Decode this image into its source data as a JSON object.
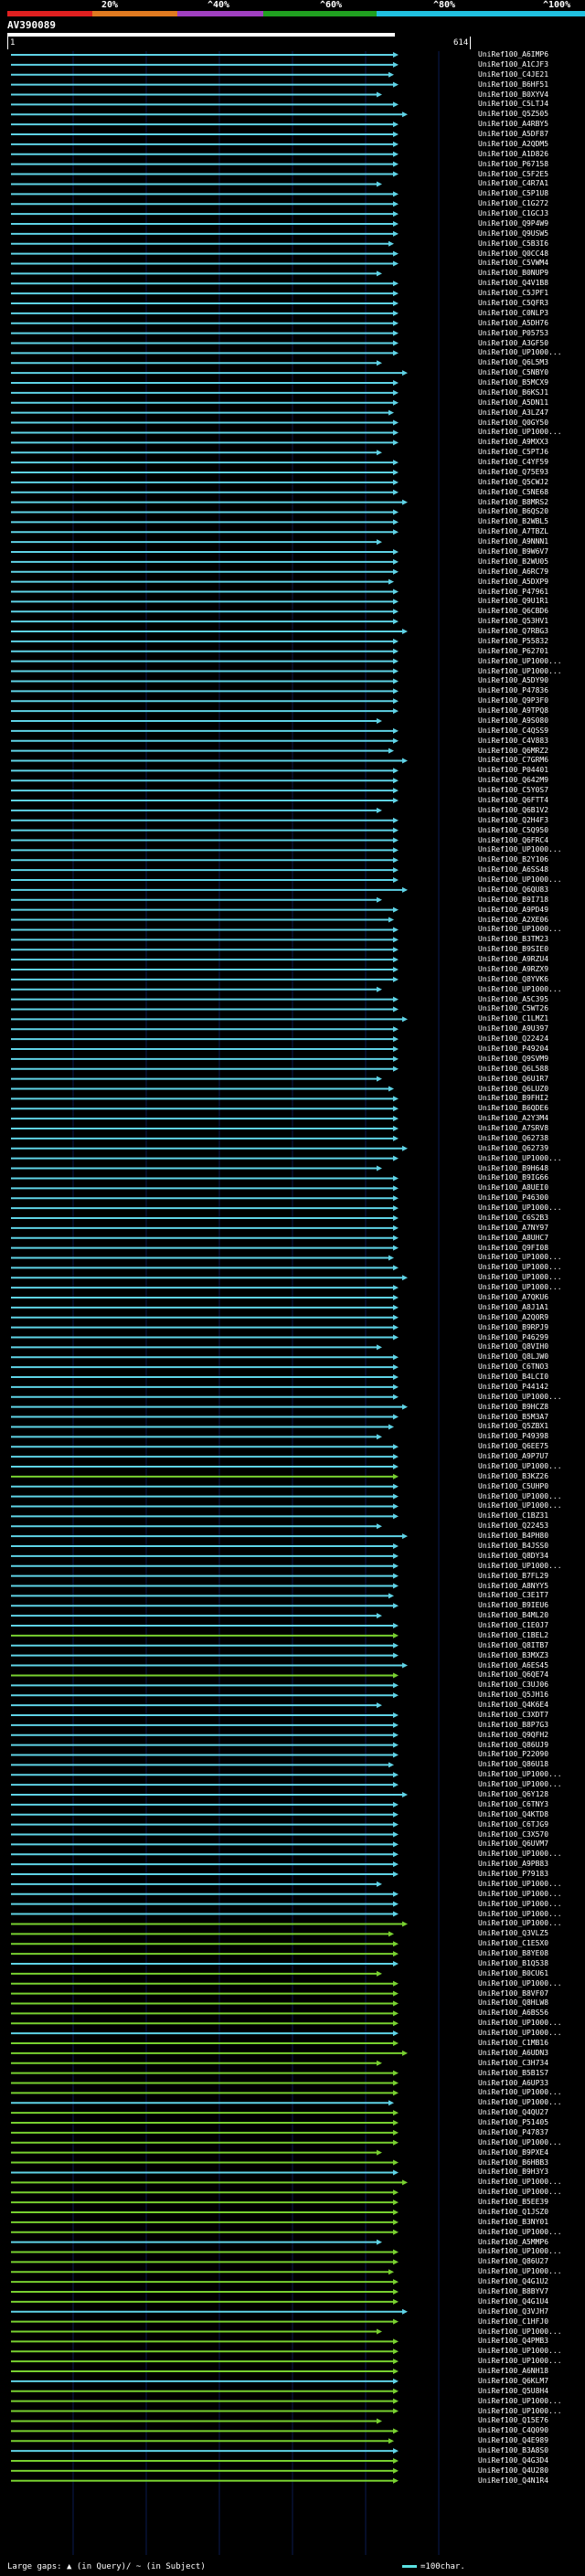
{
  "scale": {
    "ticks": [
      "20%",
      "^40%",
      "^60%",
      "^80%",
      "^100%"
    ],
    "segments": [
      {
        "color": "#e02020"
      },
      {
        "color": "#e07a20"
      },
      {
        "color": "#a040c0"
      },
      {
        "color": "#20a020"
      },
      {
        "color": "#20c0e0"
      }
    ]
  },
  "query": {
    "name": "AV390089",
    "start": "1",
    "end": "614"
  },
  "colors": {
    "cyan": "#5fd3e6",
    "green": "#78d030",
    "grid": "#0a1a50"
  },
  "hits": [
    "UniRef100_A6IMP6",
    "UniRef100_A1CJF3",
    "UniRef100_C4JE21",
    "UniRef100_B6HF51",
    "UniRef100_B0XYV4",
    "UniRef100_C5LTJ4",
    "UniRef100_Q5Z505",
    "UniRef100_A4RBY5",
    "UniRef100_A5DF87",
    "UniRef100_A2QDM5",
    "UniRef100_A1D826",
    "UniRef100_P67158",
    "UniRef100_C5F2E5",
    "UniRef100_C4R7A1",
    "UniRef100_C5P1U8",
    "UniRef100_C1G272",
    "UniRef100_C1GCJ3",
    "UniRef100_Q9P4W9",
    "UniRef100_Q9USW5",
    "UniRef100_C5B3I6",
    "UniRef100_Q0CC48",
    "UniRef100_C5VWM4",
    "UniRef100_B0NUP9",
    "UniRef100_Q4V1B8",
    "UniRef100_C5JPF1",
    "UniRef100_C5QFR3",
    "UniRef100_C0NLP3",
    "UniRef100_A5DH76",
    "UniRef100_P05753",
    "UniRef100_A3GF50",
    "UniRef100_UP1000...",
    "UniRef100_Q6L5M3",
    "UniRef100_C5NBY0",
    "UniRef100_B5MCX9",
    "UniRef100_B6KSJ1",
    "UniRef100_A5DN11",
    "UniRef100_A3LZ47",
    "UniRef100_Q0GY50",
    "UniRef100_UP1000...",
    "UniRef100_A9MXX3",
    "UniRef100_C5PTJ6",
    "UniRef100_C4YF59",
    "UniRef100_Q75E93",
    "UniRef100_Q5CWJ2",
    "UniRef100_C5NE68",
    "UniRef100_B8MRS2",
    "UniRef100_B6QS20",
    "UniRef100_B2WBL5",
    "UniRef100_A7TBZL",
    "UniRef100_A9NNN1",
    "UniRef100_B9W6V7",
    "UniRef100_B2WU05",
    "UniRef100_A6RC79",
    "UniRef100_A5DXP9",
    "UniRef100_P47961",
    "UniRef100_Q9U1R1",
    "UniRef100_Q6CBD6",
    "UniRef100_Q53HV1",
    "UniRef100_Q7RBG3",
    "UniRef100_P55832",
    "UniRef100_P62701",
    "UniRef100_UP1000...",
    "UniRef100_UP1000...",
    "UniRef100_A5DY90",
    "UniRef100_P47836",
    "UniRef100_Q9P3F0",
    "UniRef100_A9TPQ8",
    "UniRef100_A9S080",
    "UniRef100_C4QSS9",
    "UniRef100_C4V883",
    "UniRef100_Q6MRZ2",
    "UniRef100_C7GRM6",
    "UniRef100_P04401",
    "UniRef100_Q642M9",
    "UniRef100_C5Y0S7",
    "UniRef100_Q6FTT4",
    "UniRef100_Q6B1V2",
    "UniRef100_Q2H4F3",
    "UniRef100_C5Q950",
    "UniRef100_Q6FRC4",
    "UniRef100_UP1000...",
    "UniRef100_B2Y106",
    "UniRef100_A6SS48",
    "UniRef100_UP1000...",
    "UniRef100_Q6QU83",
    "UniRef100_B9I718",
    "UniRef100_A9PD49",
    "UniRef100_A2XE06",
    "UniRef100_UP1000...",
    "UniRef100_B3TM23",
    "UniRef100_B9SIE0",
    "UniRef100_A9RZU4",
    "UniRef100_A9RZX9",
    "UniRef100_Q8YVK6",
    "UniRef100_UP1000...",
    "UniRef100_A5C395",
    "UniRef100_C5WT26",
    "UniRef100_C1LMZ1",
    "UniRef100_A9U397",
    "UniRef100_Q22424",
    "UniRef100_P49204",
    "UniRef100_Q9SVM9",
    "UniRef100_Q6L588",
    "UniRef100_Q6U1R7",
    "UniRef100_Q6LUZ0",
    "UniRef100_B9FHI2",
    "UniRef100_B6QDE6",
    "UniRef100_A2Y3M4",
    "UniRef100_A7SRV8",
    "UniRef100_Q62738",
    "UniRef100_Q62739",
    "UniRef100_UP1000...",
    "UniRef100_B9H648",
    "UniRef100_B9IG66",
    "UniRef100_A8UEI0",
    "UniRef100_P46300",
    "UniRef100_UP1000...",
    "UniRef100_C6S2B3",
    "UniRef100_A7NY97",
    "UniRef100_A8UHC7",
    "UniRef100_Q9FI08",
    "UniRef100_UP1000...",
    "UniRef100_UP1000...",
    "UniRef100_UP1000...",
    "UniRef100_UP1000...",
    "UniRef100_A7QKU6",
    "UniRef100_A8J1A1",
    "UniRef100_A2Q0R9",
    "UniRef100_B9RPJ9",
    "UniRef100_P46299",
    "UniRef100_Q8VIH0",
    "UniRef100_Q8LJW0",
    "UniRef100_C6TNO3",
    "UniRef100_B4LCI0",
    "UniRef100_P44142",
    "UniRef100_UP1000...",
    "UniRef100_B9HCZ8",
    "UniRef100_B5M3A7",
    "UniRef100_Q5ZBX1",
    "UniRef100_P49398",
    "UniRef100_Q6EE75",
    "UniRef100_A9P7U7",
    "UniRef100_UP1000...",
    "UniRef100_B3KZ26",
    "UniRef100_C5UHP0",
    "UniRef100_UP1000...",
    "UniRef100_UP1000...",
    "UniRef100_C1BZ31",
    "UniRef100_Q22453",
    "UniRef100_B4PH80",
    "UniRef100_B4JSS0",
    "UniRef100_Q8DY34",
    "UniRef100_UP1000...",
    "UniRef100_B7FL29",
    "UniRef100_A8NYY5",
    "UniRef100_C3E1T7",
    "UniRef100_B9IEU6",
    "UniRef100_B4ML20",
    "UniRef100_C1E0J7",
    "UniRef100_C1BEL2",
    "UniRef100_Q8ITB7",
    "UniRef100_B3MXZ3",
    "UniRef100_A6ES45",
    "UniRef100_Q6QE74",
    "UniRef100_C3UJ06",
    "UniRef100_Q5JH16",
    "UniRef100_Q4K6E4",
    "UniRef100_C3XDT7",
    "UniRef100_B8P7G3",
    "UniRef100_Q9QFH2",
    "UniRef100_Q86UJ9",
    "UniRef100_P22090",
    "UniRef100_Q86U18",
    "UniRef100_UP1000...",
    "UniRef100_UP1000...",
    "UniRef100_Q6Y128",
    "UniRef100_C6TNY3",
    "UniRef100_Q4KTD8",
    "UniRef100_C6TJG9",
    "UniRef100_C3X570",
    "UniRef100_Q6UVM7",
    "UniRef100_UP1000...",
    "UniRef100_A9PB83",
    "UniRef100_P79183",
    "UniRef100_UP1000...",
    "UniRef100_UP1000...",
    "UniRef100_UP1000...",
    "UniRef100_UP1000...",
    "UniRef100_UP1000...",
    "UniRef100_Q3VLZ5",
    "UniRef100_C1E5X0",
    "UniRef100_B8YE08",
    "UniRef100_B1Q538",
    "UniRef100_B0CU61",
    "UniRef100_UP1000...",
    "UniRef100_B8VF07",
    "UniRef100_Q8HLW8",
    "UniRef100_A6BS56",
    "UniRef100_UP1000...",
    "UniRef100_UP1000...",
    "UniRef100_C1MB16",
    "UniRef100_A6UDN3",
    "UniRef100_C3H734",
    "UniRef100_B5B1S7",
    "UniRef100_A6UP33",
    "UniRef100_UP1000...",
    "UniRef100_UP1000...",
    "UniRef100_Q4QU27",
    "UniRef100_P51405",
    "UniRef100_P47837",
    "UniRef100_UP1000...",
    "UniRef100_B9PXE4",
    "UniRef100_B6HBB3",
    "UniRef100_B9H3Y3",
    "UniRef100_UP1000...",
    "UniRef100_UP1000...",
    "UniRef100_B5EE39",
    "UniRef100_Q1JSZ0",
    "UniRef100_B3NY01",
    "UniRef100_UP1000...",
    "UniRef100_A5MMP6",
    "UniRef100_UP1000...",
    "UniRef100_Q86U27",
    "UniRef100_UP1000...",
    "UniRef100_Q4G1U2",
    "UniRef100_B8BYV7",
    "UniRef100_Q4G1U4",
    "UniRef100_Q3VJH7",
    "UniRef100_C1HFJ0",
    "UniRef100_UP1000...",
    "UniRef100_Q4PMB3",
    "UniRef100_UP1000...",
    "UniRef100_UP1000...",
    "UniRef100_A6NH18",
    "UniRef100_Q6KLM7",
    "UniRef100_Q5U8H4",
    "UniRef100_UP1000...",
    "UniRef100_UP1000...",
    "UniRef100_Q15E76",
    "UniRef100_C4Q090",
    "UniRef100_Q4E989",
    "UniRef100_B3A8S0",
    "UniRef100_Q4G3D4",
    "UniRef100_Q4U280",
    "UniRef100_Q4N1R4"
  ],
  "legend": {
    "gaps": "Large gaps: ▲ (in Query)/ ~ (in Subject)",
    "scale": "=100char."
  }
}
